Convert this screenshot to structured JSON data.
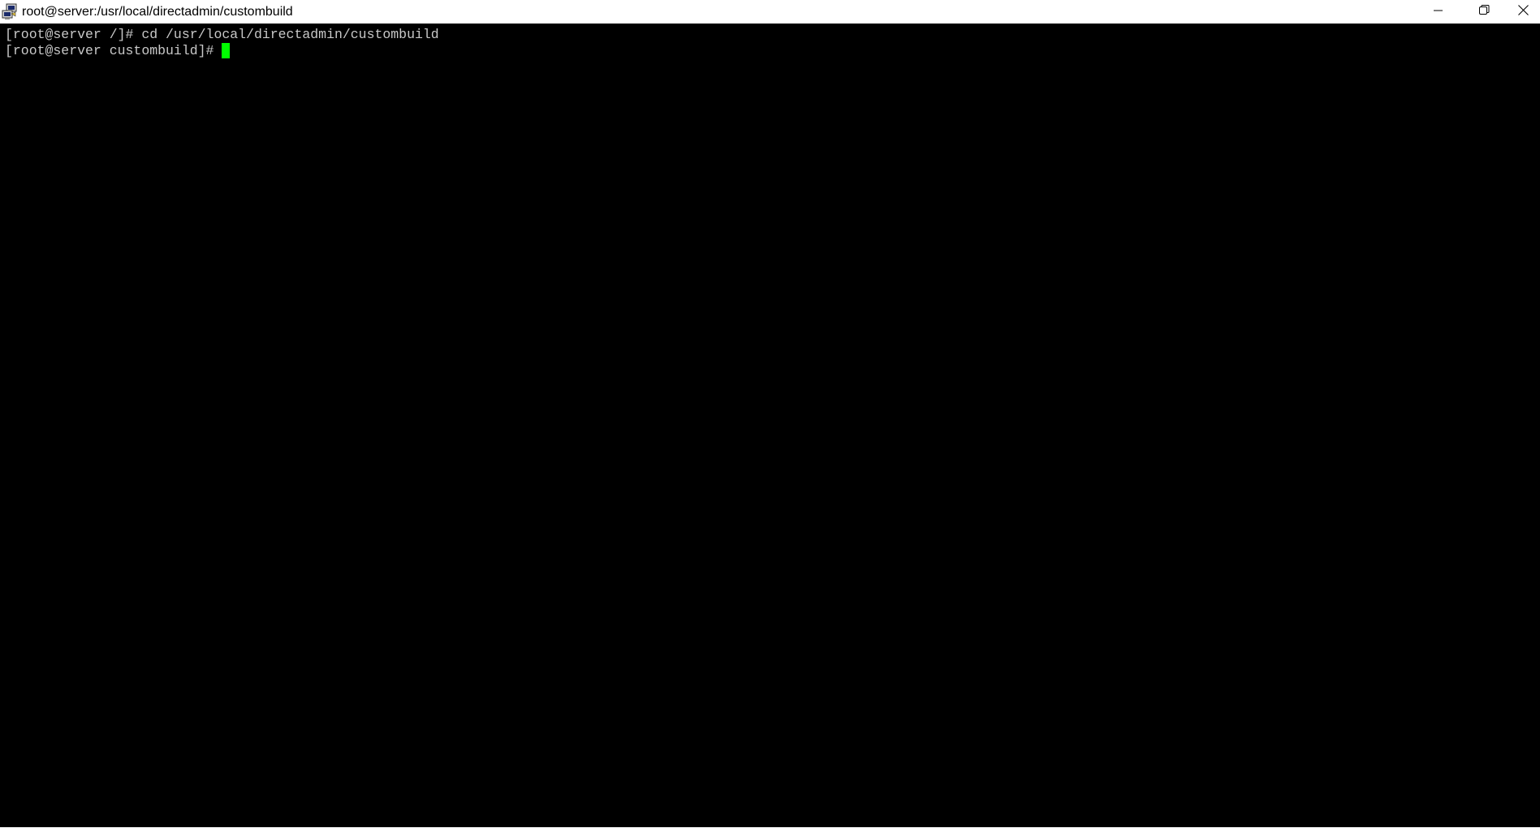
{
  "window": {
    "title": "root@server:/usr/local/directadmin/custombuild",
    "app_icon": "putty-icon",
    "controls": {
      "minimize_icon": "minimize-icon",
      "maximize_icon": "restore-icon",
      "close_icon": "close-icon"
    }
  },
  "terminal": {
    "lines": [
      "[root@server /]# cd /usr/local/directadmin/custombuild",
      "[root@server custombuild]# "
    ],
    "colors": {
      "background": "#000000",
      "foreground": "#c8c8c8",
      "cursor": "#00ff00"
    }
  }
}
